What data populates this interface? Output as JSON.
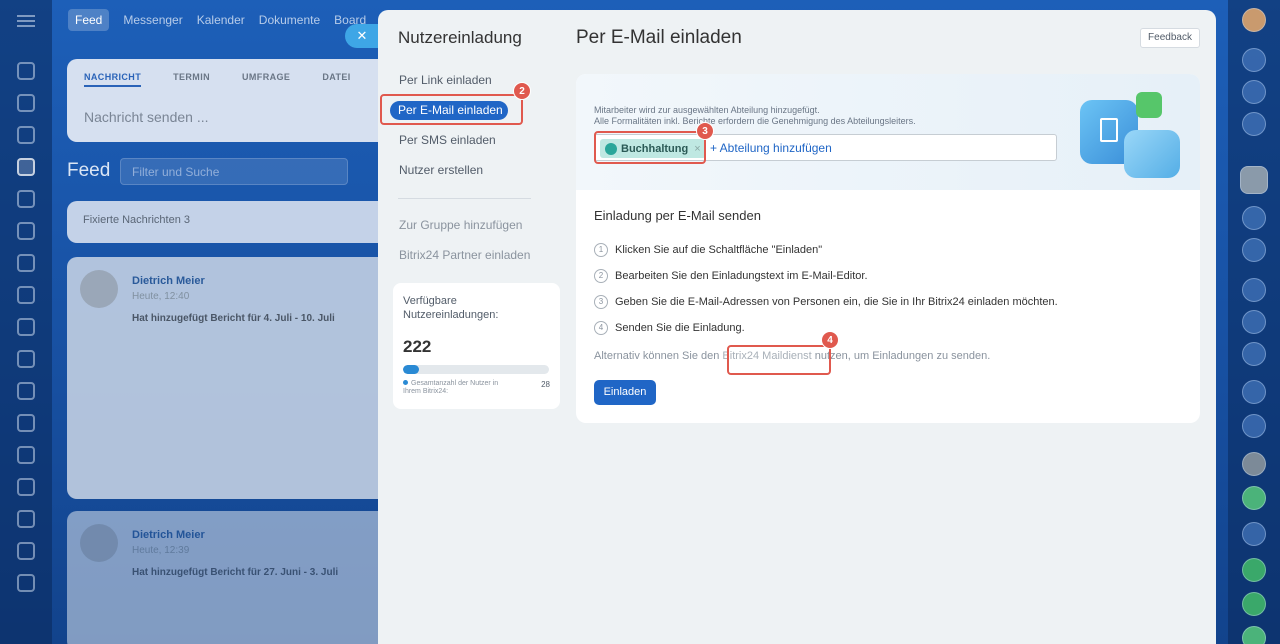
{
  "background": {
    "topnav": [
      "Feed",
      "Messenger",
      "Kalender",
      "Dokumente",
      "Board"
    ],
    "post_tabs": [
      "NACHRICHT",
      "TERMIN",
      "UMFRAGE",
      "DATEI"
    ],
    "post_placeholder": "Nachricht senden ...",
    "feed_title": "Feed",
    "filter_placeholder": "Filter und Suche",
    "pinned": "Fixierte Nachrichten 3",
    "posts": [
      {
        "author": "Dietrich Meier",
        "time": "Heute, 12:40",
        "text": "Hat hinzugefügt Bericht für 4. Juli - 10. Juli"
      },
      {
        "author": "Dietrich Meier",
        "time": "Heute, 12:39",
        "text": "Hat hinzugefügt Bericht für 27. Juni - 3. Juli"
      }
    ],
    "close_symbol": "✕"
  },
  "modal": {
    "title": "Nutzereinladung",
    "nav": {
      "by_link": "Per Link einladen",
      "by_email": "Per E-Mail einladen",
      "by_sms": "Per SMS einladen",
      "create_user": "Nutzer erstellen",
      "add_to_group": "Zur Gruppe hinzufügen",
      "partner": "Bitrix24 Partner einladen"
    },
    "stats": {
      "label": "Verfügbare Nutzereinladungen:",
      "count": "222",
      "progress_fraction": 0.11,
      "footer_label": "Gesamtanzahl der Nutzer in Ihrem Bitrix24:",
      "footer_value": "28"
    },
    "content_title": "Per E-Mail einladen",
    "feedback": "Feedback",
    "note_line1": "Mitarbeiter wird zur ausgewählten Abteilung hinzugefügt.",
    "note_line2": "Alle Formalitäten inkl. Berichte erfordern die Genehmigung des Abteilungsleiters.",
    "department_tag": "Buchhaltung",
    "tag_remove": "×",
    "add_department": "+ Abteilung hinzufügen",
    "body_title": "Einladung per E-Mail senden",
    "steps": [
      {
        "num": "1",
        "text": "Klicken Sie auf die Schaltfläche \"Einladen\""
      },
      {
        "num": "2",
        "text": "Bearbeiten Sie den Einladungstext im E-Mail-Editor."
      },
      {
        "num": "3",
        "text": "Geben Sie die E-Mail-Adressen von Personen ein, die Sie in Ihr Bitrix24 einladen möchten."
      },
      {
        "num": "4",
        "text": "Senden Sie die Einladung."
      }
    ],
    "alt_before": "Alternativ können Sie den ",
    "alt_link": "Bitrix24 Maildienst",
    "alt_after": " nutzen, um Einladungen zu senden.",
    "invite_button": "Einladen"
  },
  "annotations": {
    "b2": "2",
    "b3": "3",
    "b4": "4"
  },
  "colors": {
    "accent": "#2066c6",
    "highlight": "#e0594e",
    "tag_bg": "#bfe8e2"
  }
}
